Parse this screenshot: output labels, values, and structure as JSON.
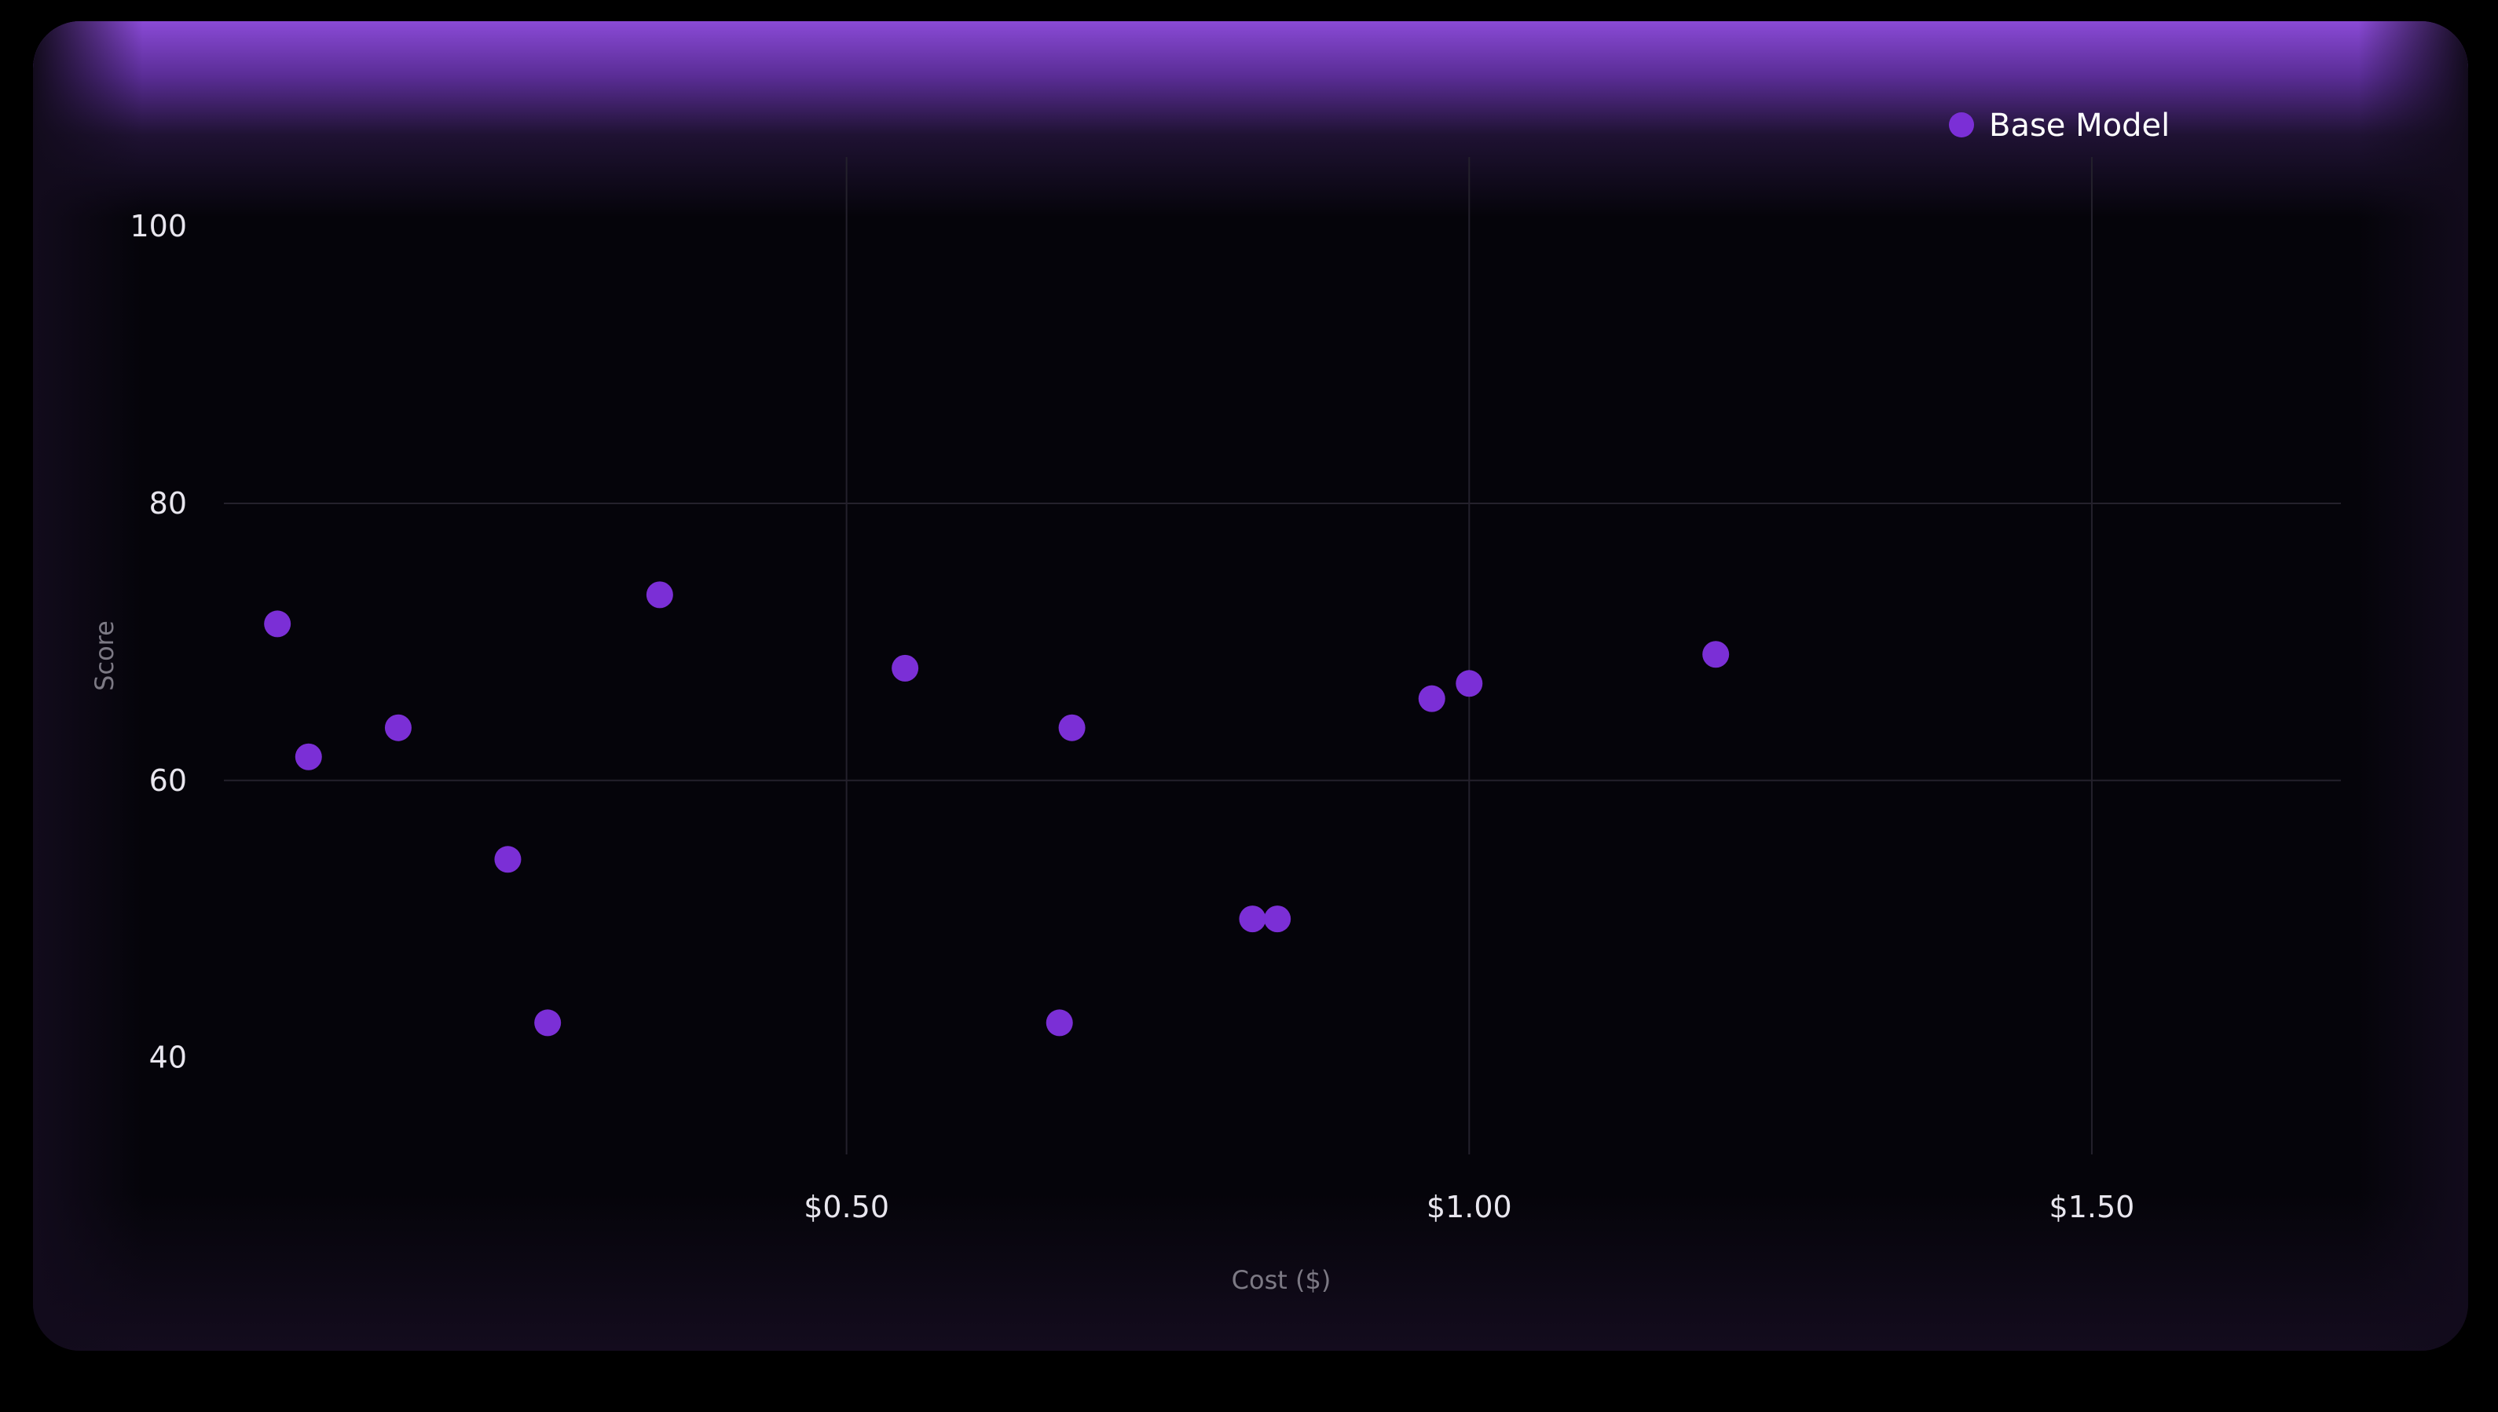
{
  "chart_data": {
    "type": "scatter",
    "xlabel": "Cost ($)",
    "ylabel": "Score",
    "xlim": [
      0,
      1.7
    ],
    "ylim": [
      33,
      105
    ],
    "xticks": [
      0.5,
      1.0,
      1.5
    ],
    "xtick_labels": [
      "$0.50",
      "$1.00",
      "$1.50"
    ],
    "yticks": [
      40,
      60,
      80,
      100
    ],
    "ytick_labels": [
      "40",
      "60",
      "80",
      "100"
    ],
    "grid": true,
    "legend_position": "top-right",
    "series": [
      {
        "name": "Base Model",
        "color": "#7b2fd6",
        "points": [
          {
            "x": 0.043,
            "y": 71.3
          },
          {
            "x": 0.068,
            "y": 61.7
          },
          {
            "x": 0.14,
            "y": 63.8
          },
          {
            "x": 0.228,
            "y": 54.3
          },
          {
            "x": 0.26,
            "y": 42.5
          },
          {
            "x": 0.35,
            "y": 73.4
          },
          {
            "x": 0.547,
            "y": 68.1
          },
          {
            "x": 0.671,
            "y": 42.5
          },
          {
            "x": 0.681,
            "y": 63.8
          },
          {
            "x": 0.826,
            "y": 50.0
          },
          {
            "x": 0.846,
            "y": 50.0
          },
          {
            "x": 0.97,
            "y": 65.9
          },
          {
            "x": 1.0,
            "y": 67.0
          },
          {
            "x": 1.198,
            "y": 69.1
          }
        ]
      }
    ]
  }
}
